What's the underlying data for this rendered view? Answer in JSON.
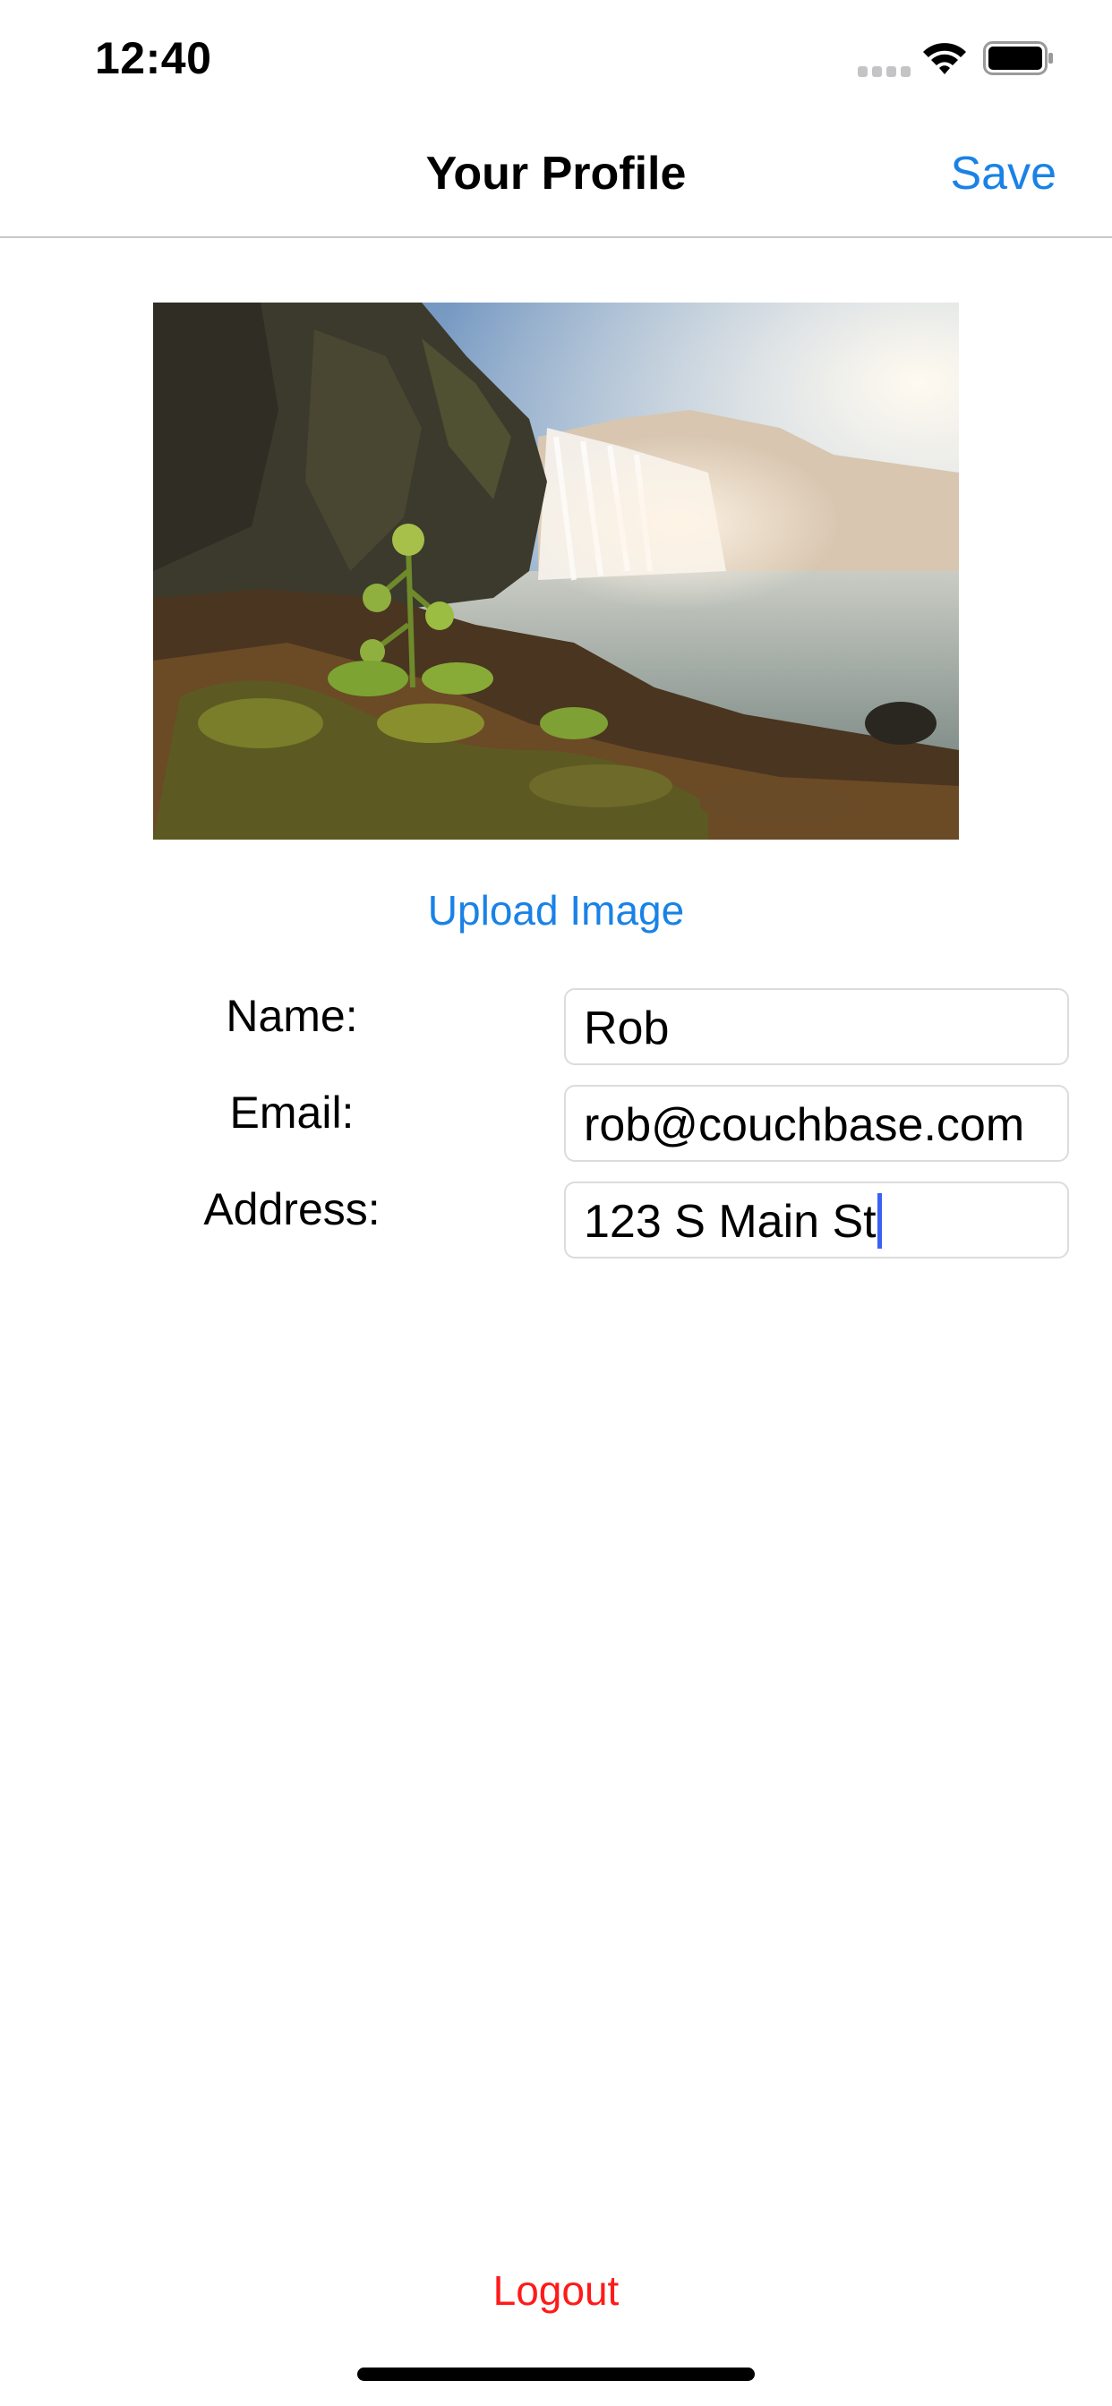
{
  "status_bar": {
    "time": "12:40",
    "icons": [
      "cellular-signal-icon",
      "wifi-icon",
      "battery-icon"
    ]
  },
  "nav": {
    "title": "Your Profile",
    "save_label": "Save"
  },
  "profile": {
    "image_subject": "waterfall landscape photo",
    "upload_label": "Upload Image"
  },
  "form": {
    "name_label": "Name:",
    "name_value": "Rob",
    "email_label": "Email:",
    "email_value": "rob@couchbase.com",
    "address_label": "Address:",
    "address_value": "123 S Main St"
  },
  "logout_label": "Logout",
  "colors": {
    "accent": "#1a82e6",
    "destructive": "#ff1a1a",
    "caret": "#3a62f2",
    "divider": "#c8c8cc"
  }
}
